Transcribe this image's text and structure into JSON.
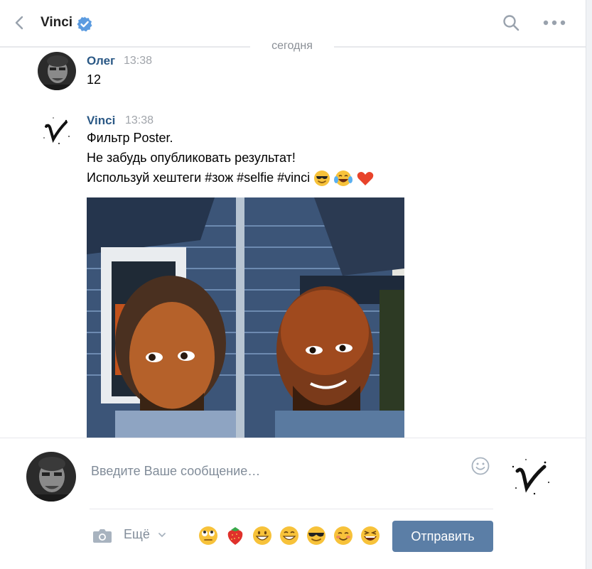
{
  "header": {
    "title": "Vinci",
    "date_separator": "сегодня"
  },
  "messages": [
    {
      "author": "Олег",
      "time": "13:38",
      "lines": [
        "12"
      ]
    },
    {
      "author": "Vinci",
      "time": "13:38",
      "lines": [
        "Фильтр Poster.",
        "Не забудь опубликовать результат!",
        "Используй хештеги #зож #selfie #vinci"
      ],
      "emojis": [
        "sunglasses-emoji",
        "tears-of-joy-emoji",
        "heart-emoji"
      ]
    }
  ],
  "composer": {
    "placeholder": "Введите Ваше сообщение…",
    "more_label": "Ещё",
    "send_label": "Отправить",
    "quick_emojis": [
      "rolling-eyes-emoji",
      "strawberry-emoji",
      "grinning-emoji",
      "grin-emoji",
      "sunglasses-emoji",
      "blush-emoji",
      "laughing-emoji"
    ]
  },
  "colors": {
    "accent": "#5b7ea6",
    "author": "#2a5885",
    "muted": "#818c99"
  }
}
